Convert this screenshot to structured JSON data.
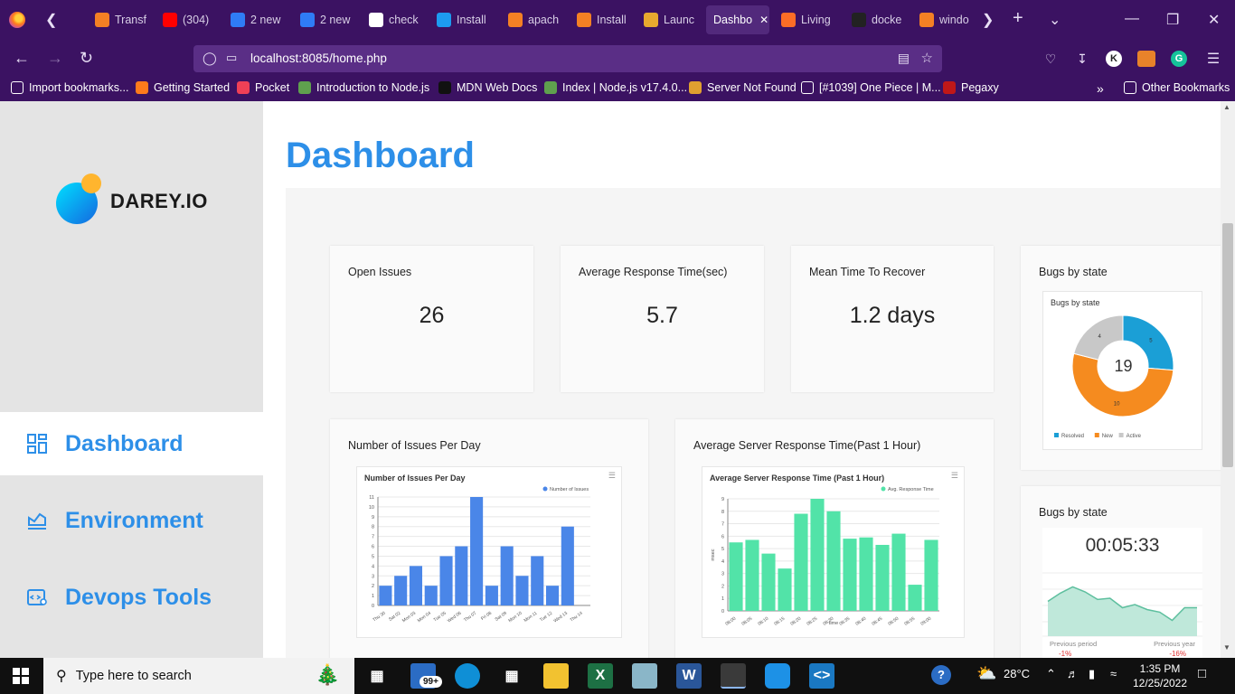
{
  "browser": {
    "tabs": [
      {
        "label": "Transf",
        "icon": "stackoverflow-icon",
        "color": "#f48024"
      },
      {
        "label": "(304)",
        "icon": "youtube-icon",
        "color": "#ff0000"
      },
      {
        "label": "2 new",
        "icon": "app-icon",
        "color": "#2f7cf6"
      },
      {
        "label": "2 new",
        "icon": "app-icon",
        "color": "#2f7cf6"
      },
      {
        "label": "check",
        "icon": "google-icon",
        "color": "#ffffff"
      },
      {
        "label": "Install",
        "icon": "globe-icon",
        "color": "#1d9bf0"
      },
      {
        "label": "apach",
        "icon": "stackoverflow-icon",
        "color": "#f48024"
      },
      {
        "label": "Install",
        "icon": "stackoverflow-icon",
        "color": "#f48024"
      },
      {
        "label": "Launc",
        "icon": "box-icon",
        "color": "#e8a92f"
      },
      {
        "label": "Dashbo",
        "icon": "",
        "color": ""
      },
      {
        "label": "Living",
        "icon": "gitlab-icon",
        "color": "#fc6d26"
      },
      {
        "label": "docke",
        "icon": "github-icon",
        "color": "#222222"
      },
      {
        "label": "windo",
        "icon": "stackoverflow-icon",
        "color": "#f48024"
      }
    ],
    "url": "localhost:8085/home.php",
    "bookmarks": [
      "Import bookmarks...",
      "Getting Started",
      "Pocket",
      "Introduction to Node.js",
      "MDN Web Docs",
      "Index | Node.js v17.4.0...",
      "Server Not Found",
      "[#1039] One Piece | M...",
      "Pegaxy"
    ],
    "other_bookmarks": "Other Bookmarks",
    "account_initial": "K"
  },
  "sidebar": {
    "brand": "DAREY.IO",
    "items": [
      {
        "label": "Dashboard",
        "icon": "dashboard-grid-icon",
        "active": true
      },
      {
        "label": "Environment",
        "icon": "environment-chart-icon",
        "active": false
      },
      {
        "label": "Devops Tools",
        "icon": "devops-tools-icon",
        "active": false
      }
    ]
  },
  "main": {
    "title": "Dashboard",
    "cards": [
      {
        "title": "Open Issues",
        "value": "26"
      },
      {
        "title": "Average Response Time(sec)",
        "value": "5.7"
      },
      {
        "title": "Mean Time To Recover",
        "value": "1.2 days"
      }
    ],
    "bugs_card": {
      "title": "Bugs by state",
      "chart_title": "Bugs by state",
      "total": "19"
    },
    "issues_card": {
      "title": "Number of Issues Per Day",
      "chart_title": "Number of Issues Per Day"
    },
    "response_card": {
      "title": "Average Server Response Time(Past 1 Hour)",
      "chart_title": "Average Server Response Time (Past 1 Hour)"
    },
    "timer_card": {
      "title": "Bugs by state",
      "timer": "00:05:33",
      "previous_period_label": "Previous period",
      "previous_period_value": "-1%",
      "previous_year_label": "Previous year",
      "previous_year_value": "-16%"
    }
  },
  "taskbar": {
    "search_placeholder": "Type here to search",
    "mail_badge": "99+",
    "weather": "28°C",
    "time": "1:35 PM",
    "date": "12/25/2022"
  },
  "chart_data": [
    {
      "type": "bar",
      "title": "Number of Issues Per Day",
      "categories": [
        "Thu 30",
        "Sat 02",
        "Mon 03",
        "Mon 04",
        "Tue 05",
        "Wed 06",
        "Thu 07",
        "Fri 08",
        "Sat 09",
        "Mon 10",
        "Mon 11",
        "Tue 12",
        "Wed 13",
        "Thu 14"
      ],
      "series": [
        {
          "name": "Number of Issues",
          "values": [
            2,
            3,
            4,
            2,
            5,
            6,
            11,
            2,
            6,
            3,
            5,
            2,
            8,
            null
          ]
        }
      ],
      "ylim": [
        0,
        11
      ],
      "yticks": [
        0,
        1,
        2,
        3,
        4,
        5,
        6,
        7,
        8,
        9,
        10,
        11
      ],
      "legend": "top-right",
      "grid": true,
      "color": "#4a86e8"
    },
    {
      "type": "bar",
      "title": "Average Server Response Time (Past 1 Hour)",
      "categories": [
        "08:00",
        "08:05",
        "08:10",
        "08:15",
        "08:20",
        "08:25",
        "08:30",
        "08:35",
        "08:40",
        "08:45",
        "08:50",
        "08:55",
        "09:00"
      ],
      "series": [
        {
          "name": "Avg. Response Time",
          "values": [
            5.5,
            5.7,
            4.6,
            3.4,
            7.8,
            9.0,
            8.0,
            5.8,
            5.9,
            5.3,
            6.2,
            2.1,
            5.7
          ]
        }
      ],
      "xlabel": "time",
      "ylabel": "msec",
      "ylim": [
        0,
        9
      ],
      "yticks": [
        0,
        1,
        2,
        3,
        4,
        5,
        6,
        7,
        8,
        9
      ],
      "legend": "top-right",
      "grid": true,
      "color": "#52e3a8"
    },
    {
      "type": "pie",
      "title": "Bugs by state",
      "categories": [
        "Resolved",
        "New",
        "Active"
      ],
      "values": [
        5,
        10,
        4
      ],
      "colors": [
        "#1b9fd6",
        "#f58b1f",
        "#c8c8c8"
      ],
      "legend": "bottom"
    },
    {
      "type": "area",
      "values": [
        0.55,
        0.68,
        0.78,
        0.7,
        0.58,
        0.6,
        0.45,
        0.5,
        0.42,
        0.38,
        0.25,
        0.45,
        0.45
      ],
      "color": "#5dbf9e"
    }
  ]
}
